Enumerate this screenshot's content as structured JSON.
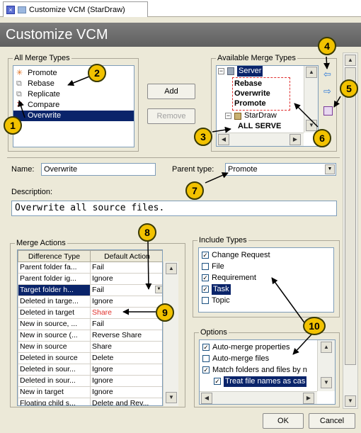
{
  "tab": {
    "label": "Customize VCM (StarDraw)"
  },
  "header": {
    "title": "Customize VCM"
  },
  "all_merge_types": {
    "legend": "All Merge Types",
    "items": [
      "Promote",
      "Rebase",
      "Replicate",
      "Compare",
      "Overwrite"
    ],
    "selected": "Overwrite"
  },
  "buttons": {
    "add": "Add",
    "remove": "Remove",
    "ok": "OK",
    "cancel": "Cancel"
  },
  "available_merge_types": {
    "legend": "Available Merge Types",
    "tree": {
      "server_label": "Server",
      "server_children": [
        "Rebase",
        "Overwrite",
        "Promote"
      ],
      "stardraw_label": "StarDraw",
      "stardraw_children": [
        "ALL SERVE"
      ]
    }
  },
  "form": {
    "name_label": "Name:",
    "name_value": "Overwrite",
    "parent_type_label": "Parent type:",
    "parent_type_value": "Promote",
    "description_label": "Description:",
    "description_value": "Overwrite all source files."
  },
  "merge_actions": {
    "legend": "Merge Actions",
    "columns": [
      "Difference Type",
      "Default Action"
    ],
    "rows": [
      [
        "Parent folder fa...",
        "Fail"
      ],
      [
        "Parent folder ig...",
        "Ignore"
      ],
      [
        "Target folder h...",
        "Fail"
      ],
      [
        "Deleted in targe...",
        "Ignore"
      ],
      [
        "Deleted in target",
        "Share"
      ],
      [
        "New in source, ...",
        "Fail"
      ],
      [
        "New in source (...",
        "Reverse Share"
      ],
      [
        "New in source",
        "Share"
      ],
      [
        "Deleted in source",
        "Delete"
      ],
      [
        "Deleted in sour...",
        "Ignore"
      ],
      [
        "Deleted in sour...",
        "Ignore"
      ],
      [
        "New in target",
        "Ignore"
      ],
      [
        "Floating child s...",
        "Delete and Rev..."
      ]
    ]
  },
  "include_types": {
    "legend": "Include Types",
    "items": [
      {
        "label": "Change Request",
        "checked": true
      },
      {
        "label": "File",
        "checked": false
      },
      {
        "label": "Requirement",
        "checked": true
      },
      {
        "label": "Task",
        "checked": true
      },
      {
        "label": "Topic",
        "checked": false
      }
    ]
  },
  "options": {
    "legend": "Options",
    "items": [
      {
        "label": "Auto-merge properties",
        "checked": true
      },
      {
        "label": "Auto-merge files",
        "checked": false
      },
      {
        "label": "Match folders and files by n",
        "checked": true
      },
      {
        "label": "Treat file names as cas",
        "checked": true
      }
    ]
  },
  "callouts": [
    "1",
    "2",
    "3",
    "4",
    "5",
    "6",
    "7",
    "8",
    "9",
    "10"
  ],
  "colors": {
    "selection": "#0a246a",
    "callout": "#f2c200",
    "highlight_red": "#e0302a",
    "header_bg": "#6a6a6a"
  }
}
